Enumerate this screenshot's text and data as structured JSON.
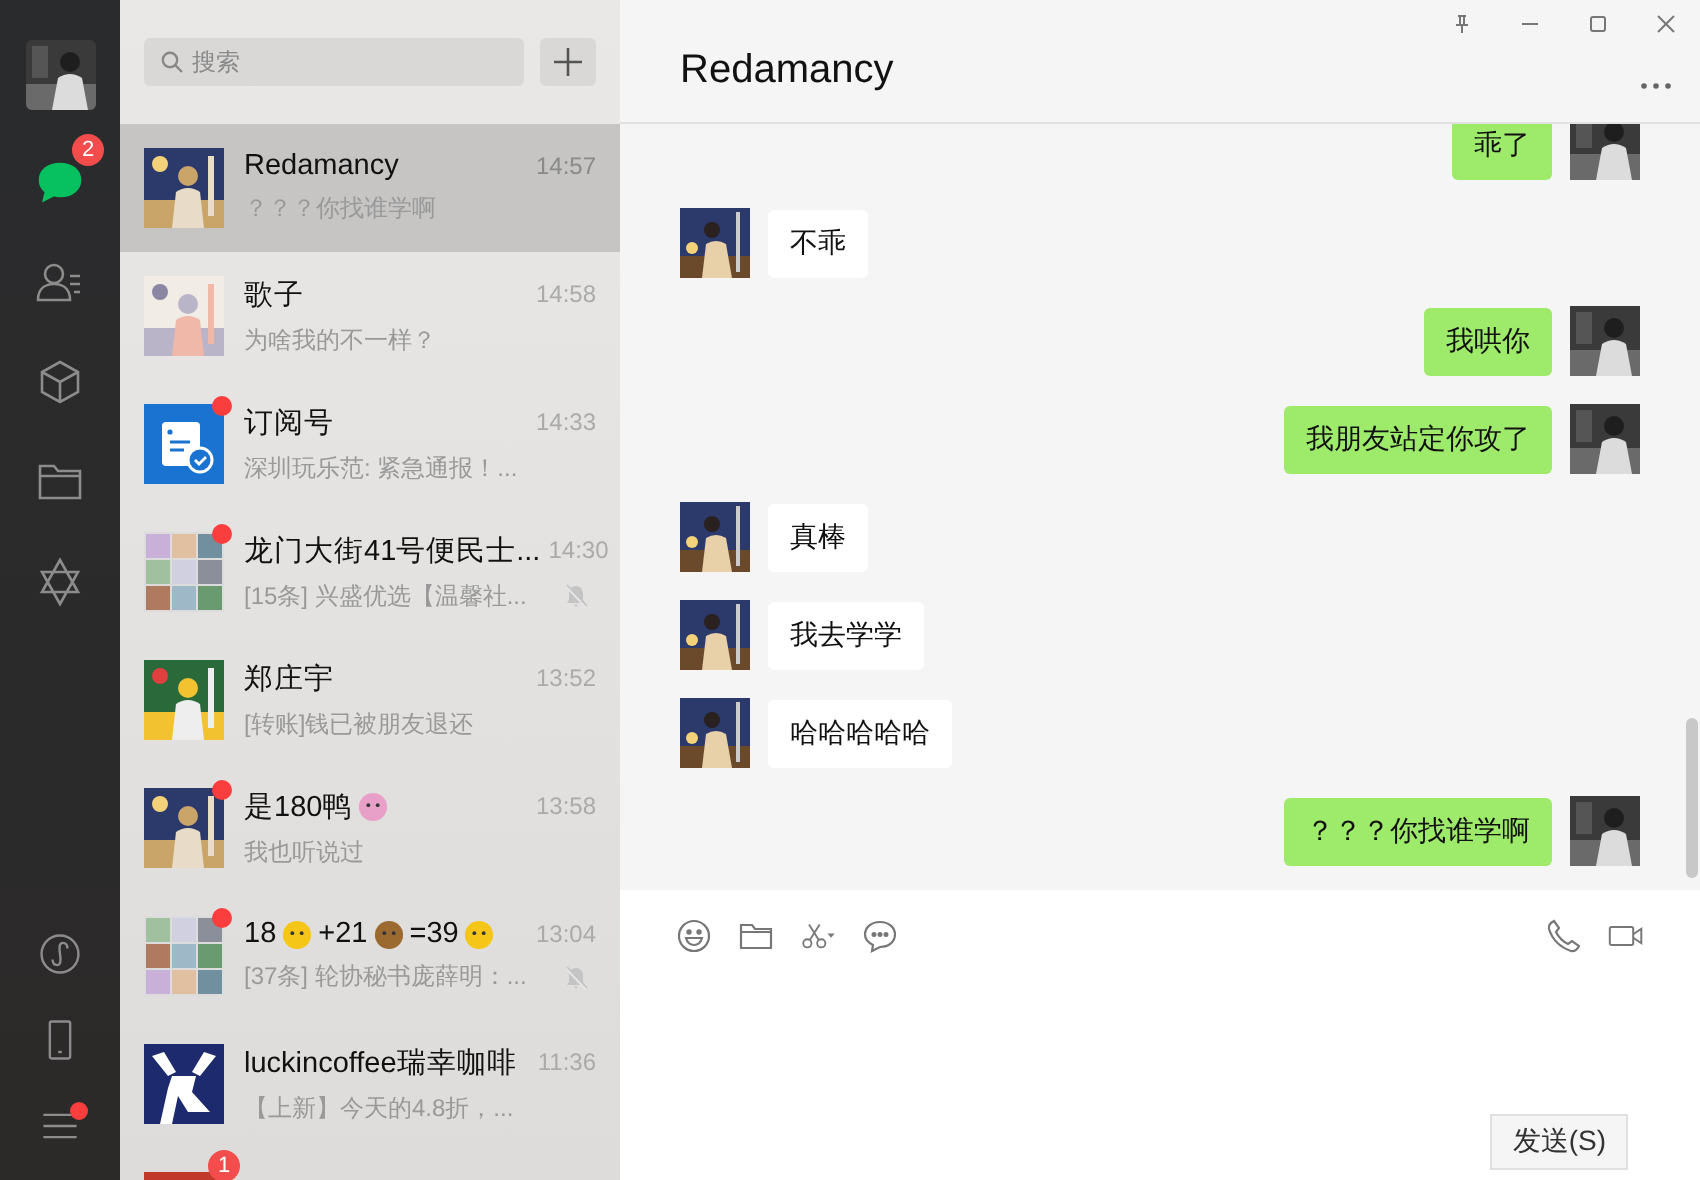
{
  "sidebar": {
    "nav": [
      {
        "kind": "chats",
        "selected": true,
        "badge": "2"
      },
      {
        "kind": "contacts",
        "selected": false
      },
      {
        "kind": "favorites",
        "selected": false
      },
      {
        "kind": "files",
        "selected": false
      },
      {
        "kind": "moments",
        "selected": false
      }
    ],
    "bottom": [
      {
        "kind": "miniprograms",
        "dot": false
      },
      {
        "kind": "phone",
        "dot": false
      },
      {
        "kind": "menu",
        "dot": true
      }
    ]
  },
  "search": {
    "placeholder": "搜索"
  },
  "conversations": [
    {
      "name": "Redamancy",
      "time": "14:57",
      "preview": "？？？你找谁学啊",
      "selected": true,
      "unread": false,
      "muted": false
    },
    {
      "name": "歌子",
      "time": "14:58",
      "preview": "为啥我的不一样？",
      "selected": false,
      "unread": false,
      "muted": false
    },
    {
      "kind": "official",
      "name": "订阅号",
      "time": "14:33",
      "preview": "深圳玩乐范: 紧急通报！...",
      "selected": false,
      "unread": true,
      "muted": false
    },
    {
      "kind": "group",
      "name": "龙门大街41号便民士...",
      "time": "14:30",
      "preview": "[15条] 兴盛优选【温馨社...",
      "selected": false,
      "unread": true,
      "muted": true
    },
    {
      "name": "郑庄宇",
      "time": "13:52",
      "preview": "[转账]钱已被朋友退还",
      "selected": false,
      "unread": false,
      "muted": false
    },
    {
      "name_parts": [
        {
          "kind": "text",
          "text": "是180鸭"
        },
        {
          "kind": "emoji"
        }
      ],
      "time": "13:58",
      "preview": "我也听说过",
      "selected": false,
      "unread": true,
      "muted": false
    },
    {
      "kind": "group",
      "name_parts": [
        {
          "kind": "text",
          "text": "18"
        },
        {
          "kind": "emoji"
        },
        {
          "kind": "text",
          "text": "+21"
        },
        {
          "kind": "emoji"
        },
        {
          "kind": "text",
          "text": "=39"
        },
        {
          "kind": "emoji"
        }
      ],
      "time": "13:04",
      "preview": "[37条] 轮协秘书庞薛明：...",
      "selected": false,
      "unread": true,
      "muted": true
    },
    {
      "kind": "brand",
      "name": "luckincoffee瑞幸咖啡",
      "time": "11:36",
      "preview": "【上新】今天的4.8折，...",
      "selected": false,
      "unread": false,
      "muted": false
    },
    {
      "badge": "1",
      "selected": false,
      "unread": false,
      "muted": false
    }
  ],
  "chat": {
    "title": "Redamancy",
    "messages": [
      {
        "kind": "sent",
        "text": "乖了"
      },
      {
        "kind": "received",
        "text": "不乖"
      },
      {
        "kind": "sent",
        "text": "我哄你"
      },
      {
        "kind": "sent",
        "text": "我朋友站定你攻了"
      },
      {
        "kind": "received",
        "text": "真棒"
      },
      {
        "kind": "received",
        "text": "我去学学"
      },
      {
        "kind": "received",
        "text": "哈哈哈哈哈"
      },
      {
        "kind": "sent",
        "text": "？？？你找谁学啊"
      }
    ],
    "send_button": "发送(S)"
  }
}
